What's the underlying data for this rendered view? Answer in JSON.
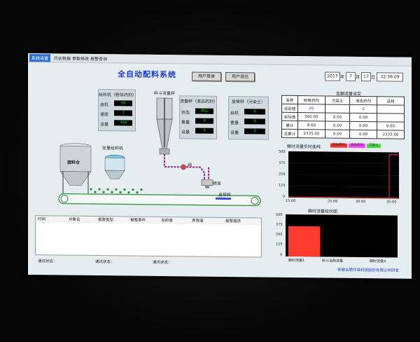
{
  "menu": [
    "系统设置",
    "历史数据",
    "参数修改",
    "报警查询"
  ],
  "title": "全自动配料系统",
  "buttons": {
    "login": "用户登录",
    "logout": "用户退出"
  },
  "datetime": {
    "year": "2017",
    "year_unit": "年",
    "month": "7",
    "month_unit": "月",
    "day": "17",
    "day_unit": "日",
    "time": "22:36:09"
  },
  "feeder_panel": {
    "title": "给料机（粉体药剂）",
    "rows": [
      {
        "label": "启机",
        "value": "50"
      },
      {
        "label": "速度",
        "value": "2"
      },
      {
        "label": "设量",
        "value": "360"
      }
    ]
  },
  "scale_label": "料斗流量秤",
  "flow_scale_panel": {
    "title": "流量秤（液态药剂）",
    "rows": [
      {
        "label": "状态",
        "value": "停止"
      },
      {
        "label": "重量",
        "value": "0"
      },
      {
        "label": "设量",
        "value": "0"
      }
    ]
  },
  "skin_scale_panel": {
    "title": "皮带秤（污染土）",
    "rows": [
      {
        "label": "启机",
        "value": "0"
      },
      {
        "label": "重量",
        "value": "0"
      },
      {
        "label": "设量",
        "value": "0"
      }
    ]
  },
  "silo_label": "旋料仓",
  "feeder_tank_label": "定量给料机",
  "valve_label": "阀",
  "pump_label": "喷泵",
  "belt_scale_label": "皮带秤",
  "qty_title": "定额流量设定",
  "qty_table": {
    "header": [
      "名称",
      "粉体药剂",
      "污染土",
      "液态药剂",
      "总和"
    ],
    "rows": [
      [
        "设定值",
        "20",
        "",
        "0",
        ""
      ],
      [
        "实际值",
        "360.00",
        "0.00",
        "0.00",
        ""
      ],
      [
        "累计",
        "8.60",
        "0.00",
        "0.00",
        "8.60"
      ],
      [
        "总累计",
        "2335.00",
        "0.00",
        "0.00",
        "2335.00"
      ]
    ]
  },
  "line_chart": {
    "title": "瞬时流量实时曲线",
    "legend": [
      {
        "name": "粉体药剂",
        "color": "#ff3030"
      },
      {
        "name": "液态药剂",
        "color": "#ff44ff"
      },
      {
        "name": "污染土",
        "color": "#44dd44"
      }
    ],
    "y_ticks": [
      "500",
      "375",
      "250",
      "125",
      "0"
    ],
    "x_ticks": [
      "15:00",
      "25:00",
      "30:00",
      "35:00"
    ]
  },
  "bar_chart": {
    "title": "瞬时流量柱状图",
    "y_ticks": [
      "500",
      "375",
      "250",
      "125",
      "0"
    ],
    "categories": [
      "瞬时流量1",
      "料斗当前流量",
      "瞬时流量X"
    ]
  },
  "chart_data": [
    {
      "type": "line",
      "title": "瞬时流量实时曲线",
      "ylim": [
        0,
        500
      ],
      "x": [
        "15:00",
        "25:00",
        "30:00",
        "35:00"
      ],
      "series": [
        {
          "name": "粉体药剂",
          "values": [
            0,
            0,
            0,
            0
          ]
        }
      ]
    },
    {
      "type": "bar",
      "title": "瞬时流量柱状图",
      "ylim": [
        0,
        500
      ],
      "categories": [
        "瞬时流量1",
        "料斗当前流量",
        "瞬时流量X"
      ],
      "values": [
        360,
        0,
        0
      ]
    }
  ],
  "alarm_columns": [
    "时间",
    "对象名",
    "报警类型",
    "报警事件",
    "当前值",
    "界限值",
    "报警描述"
  ],
  "status_bar": [
    "通讯状态：",
    "通讯状态：",
    "通讯状态："
  ],
  "footer": "安徽合肥环境科技股份有限公司研发",
  "colors": {
    "title": "#1a3bd4",
    "digit": "#00e000",
    "bar": "#ff3b30",
    "pipe": "#a0208e"
  }
}
